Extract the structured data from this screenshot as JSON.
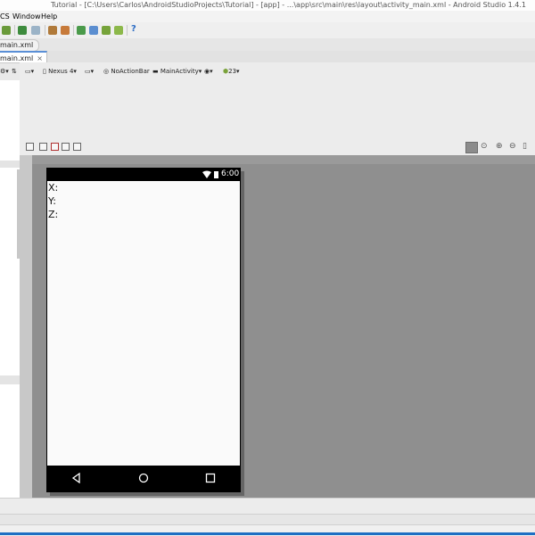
{
  "window": {
    "title": "Tutorial - [C:\\Users\\Carlos\\AndroidStudioProjects\\Tutorial] - [app] - ...\\app\\src\\main\\res\\layout\\activity_main.xml - Android Studio 1.4.1"
  },
  "menu": {
    "items": [
      "CS",
      "Window",
      "Help"
    ]
  },
  "breadcrumb": {
    "file": "main.xml"
  },
  "editor_tab": {
    "label": "main.xml",
    "close": "×"
  },
  "design_toolbar": {
    "device": "Nexus 4",
    "theme": "NoActionBar",
    "activity": "MainActivity",
    "api": "23"
  },
  "preview": {
    "status_time": "6:00",
    "labels": [
      "X:",
      "Y:",
      "Z:"
    ]
  },
  "colors": {
    "canvas_bg": "#8f8f8f",
    "phone_body": "#000000",
    "screen_bg": "#fafafa",
    "taskbar": "#1e6fc3"
  },
  "icons": {
    "nav_back": "back-triangle-icon",
    "nav_home": "home-circle-icon",
    "nav_recent": "recent-square-icon"
  }
}
